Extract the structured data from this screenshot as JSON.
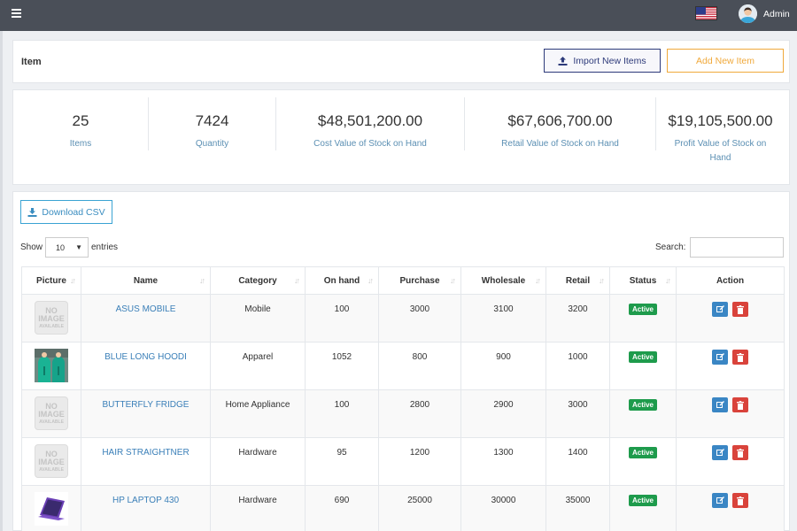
{
  "topbar": {
    "user": "Admin",
    "menu_icon": "hamburger-icon",
    "flag_icon": "us-flag-icon",
    "avatar_icon": "user-avatar-icon"
  },
  "header": {
    "title": "Item",
    "import_label": "Import New Items",
    "add_label": "Add New Item"
  },
  "stats": [
    {
      "value": "25",
      "label": "Items"
    },
    {
      "value": "7424",
      "label": "Quantity"
    },
    {
      "value": "$48,501,200.00",
      "label": "Cost Value of Stock on Hand"
    },
    {
      "value": "$67,606,700.00",
      "label": "Retail Value of Stock on Hand"
    },
    {
      "value": "$19,105,500.00",
      "label": "Profit Value of Stock on Hand"
    }
  ],
  "table": {
    "download_label": "Download CSV",
    "show_label": "Show",
    "page_size": "10",
    "entries_label": "entries",
    "search_label": "Search:",
    "columns": [
      "Picture",
      "Name",
      "Category",
      "On hand",
      "Purchase",
      "Wholesale",
      "Retail",
      "Status",
      "Action"
    ],
    "rows": [
      {
        "picture": "no-image",
        "name": "ASUS MOBILE",
        "category": "Mobile",
        "on_hand": "100",
        "purchase": "3000",
        "wholesale": "3100",
        "retail": "3200",
        "status": "Active"
      },
      {
        "picture": "hoodie-photo",
        "name": "BLUE LONG HOODI",
        "category": "Apparel",
        "on_hand": "1052",
        "purchase": "800",
        "wholesale": "900",
        "retail": "1000",
        "status": "Active"
      },
      {
        "picture": "no-image",
        "name": "BUTTERFLY FRIDGE",
        "category": "Home Appliance",
        "on_hand": "100",
        "purchase": "2800",
        "wholesale": "2900",
        "retail": "3000",
        "status": "Active"
      },
      {
        "picture": "no-image",
        "name": "HAIR STRAIGHTNER",
        "category": "Hardware",
        "on_hand": "95",
        "purchase": "1200",
        "wholesale": "1300",
        "retail": "1400",
        "status": "Active"
      },
      {
        "picture": "laptop-photo",
        "name": "HP LAPTOP 430",
        "category": "Hardware",
        "on_hand": "690",
        "purchase": "25000",
        "wholesale": "30000",
        "retail": "35000",
        "status": "Active"
      }
    ]
  },
  "no_image": {
    "line1": "NO",
    "line2": "IMAGE",
    "line3": "AVAILABLE"
  },
  "colors": {
    "topbar": "#4a4f58",
    "accent_blue": "#3a7fb8",
    "accent_orange": "#f0a93b",
    "status_green": "#1e9b4c",
    "delete_red": "#d9433b"
  }
}
